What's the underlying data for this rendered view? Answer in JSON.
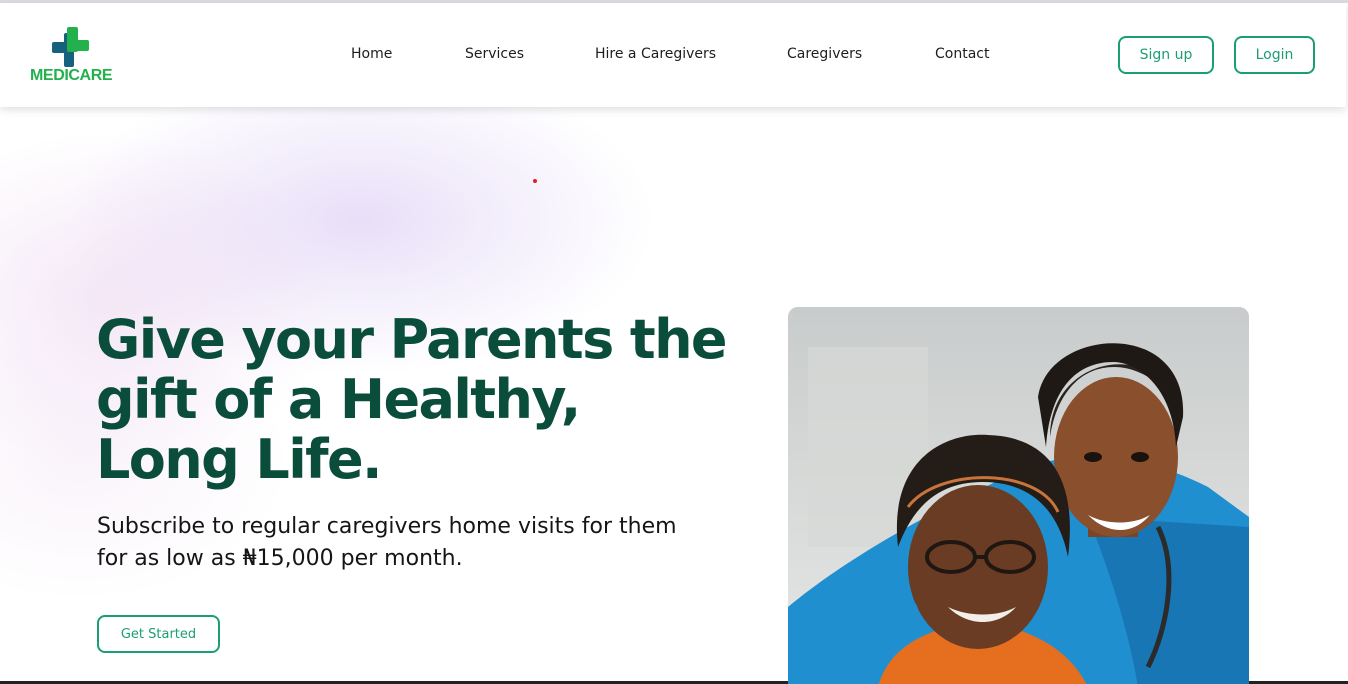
{
  "brand": {
    "name": "MEDICARE",
    "primary_color": "#1a9e76",
    "logo_green": "#22b14c",
    "logo_blue": "#16617e",
    "heading_color": "#0a4d3b"
  },
  "nav": {
    "items": [
      {
        "label": "Home"
      },
      {
        "label": "Services"
      },
      {
        "label": "Hire a Caregivers"
      },
      {
        "label": "Caregivers"
      },
      {
        "label": "Contact"
      }
    ]
  },
  "auth": {
    "signup_label": "Sign up",
    "login_label": "Login"
  },
  "hero": {
    "title_line1": "Give your Parents the",
    "title_line2": "gift of a Healthy,",
    "title_line3": "Long Life.",
    "subtitle_line1": "Subscribe to regular caregivers home visits for them",
    "subtitle_line2": "for as low as ₦15,000 per month.",
    "cta_label": "Get Started",
    "image_icon": "caregiver-with-elderly-woman-photo"
  }
}
